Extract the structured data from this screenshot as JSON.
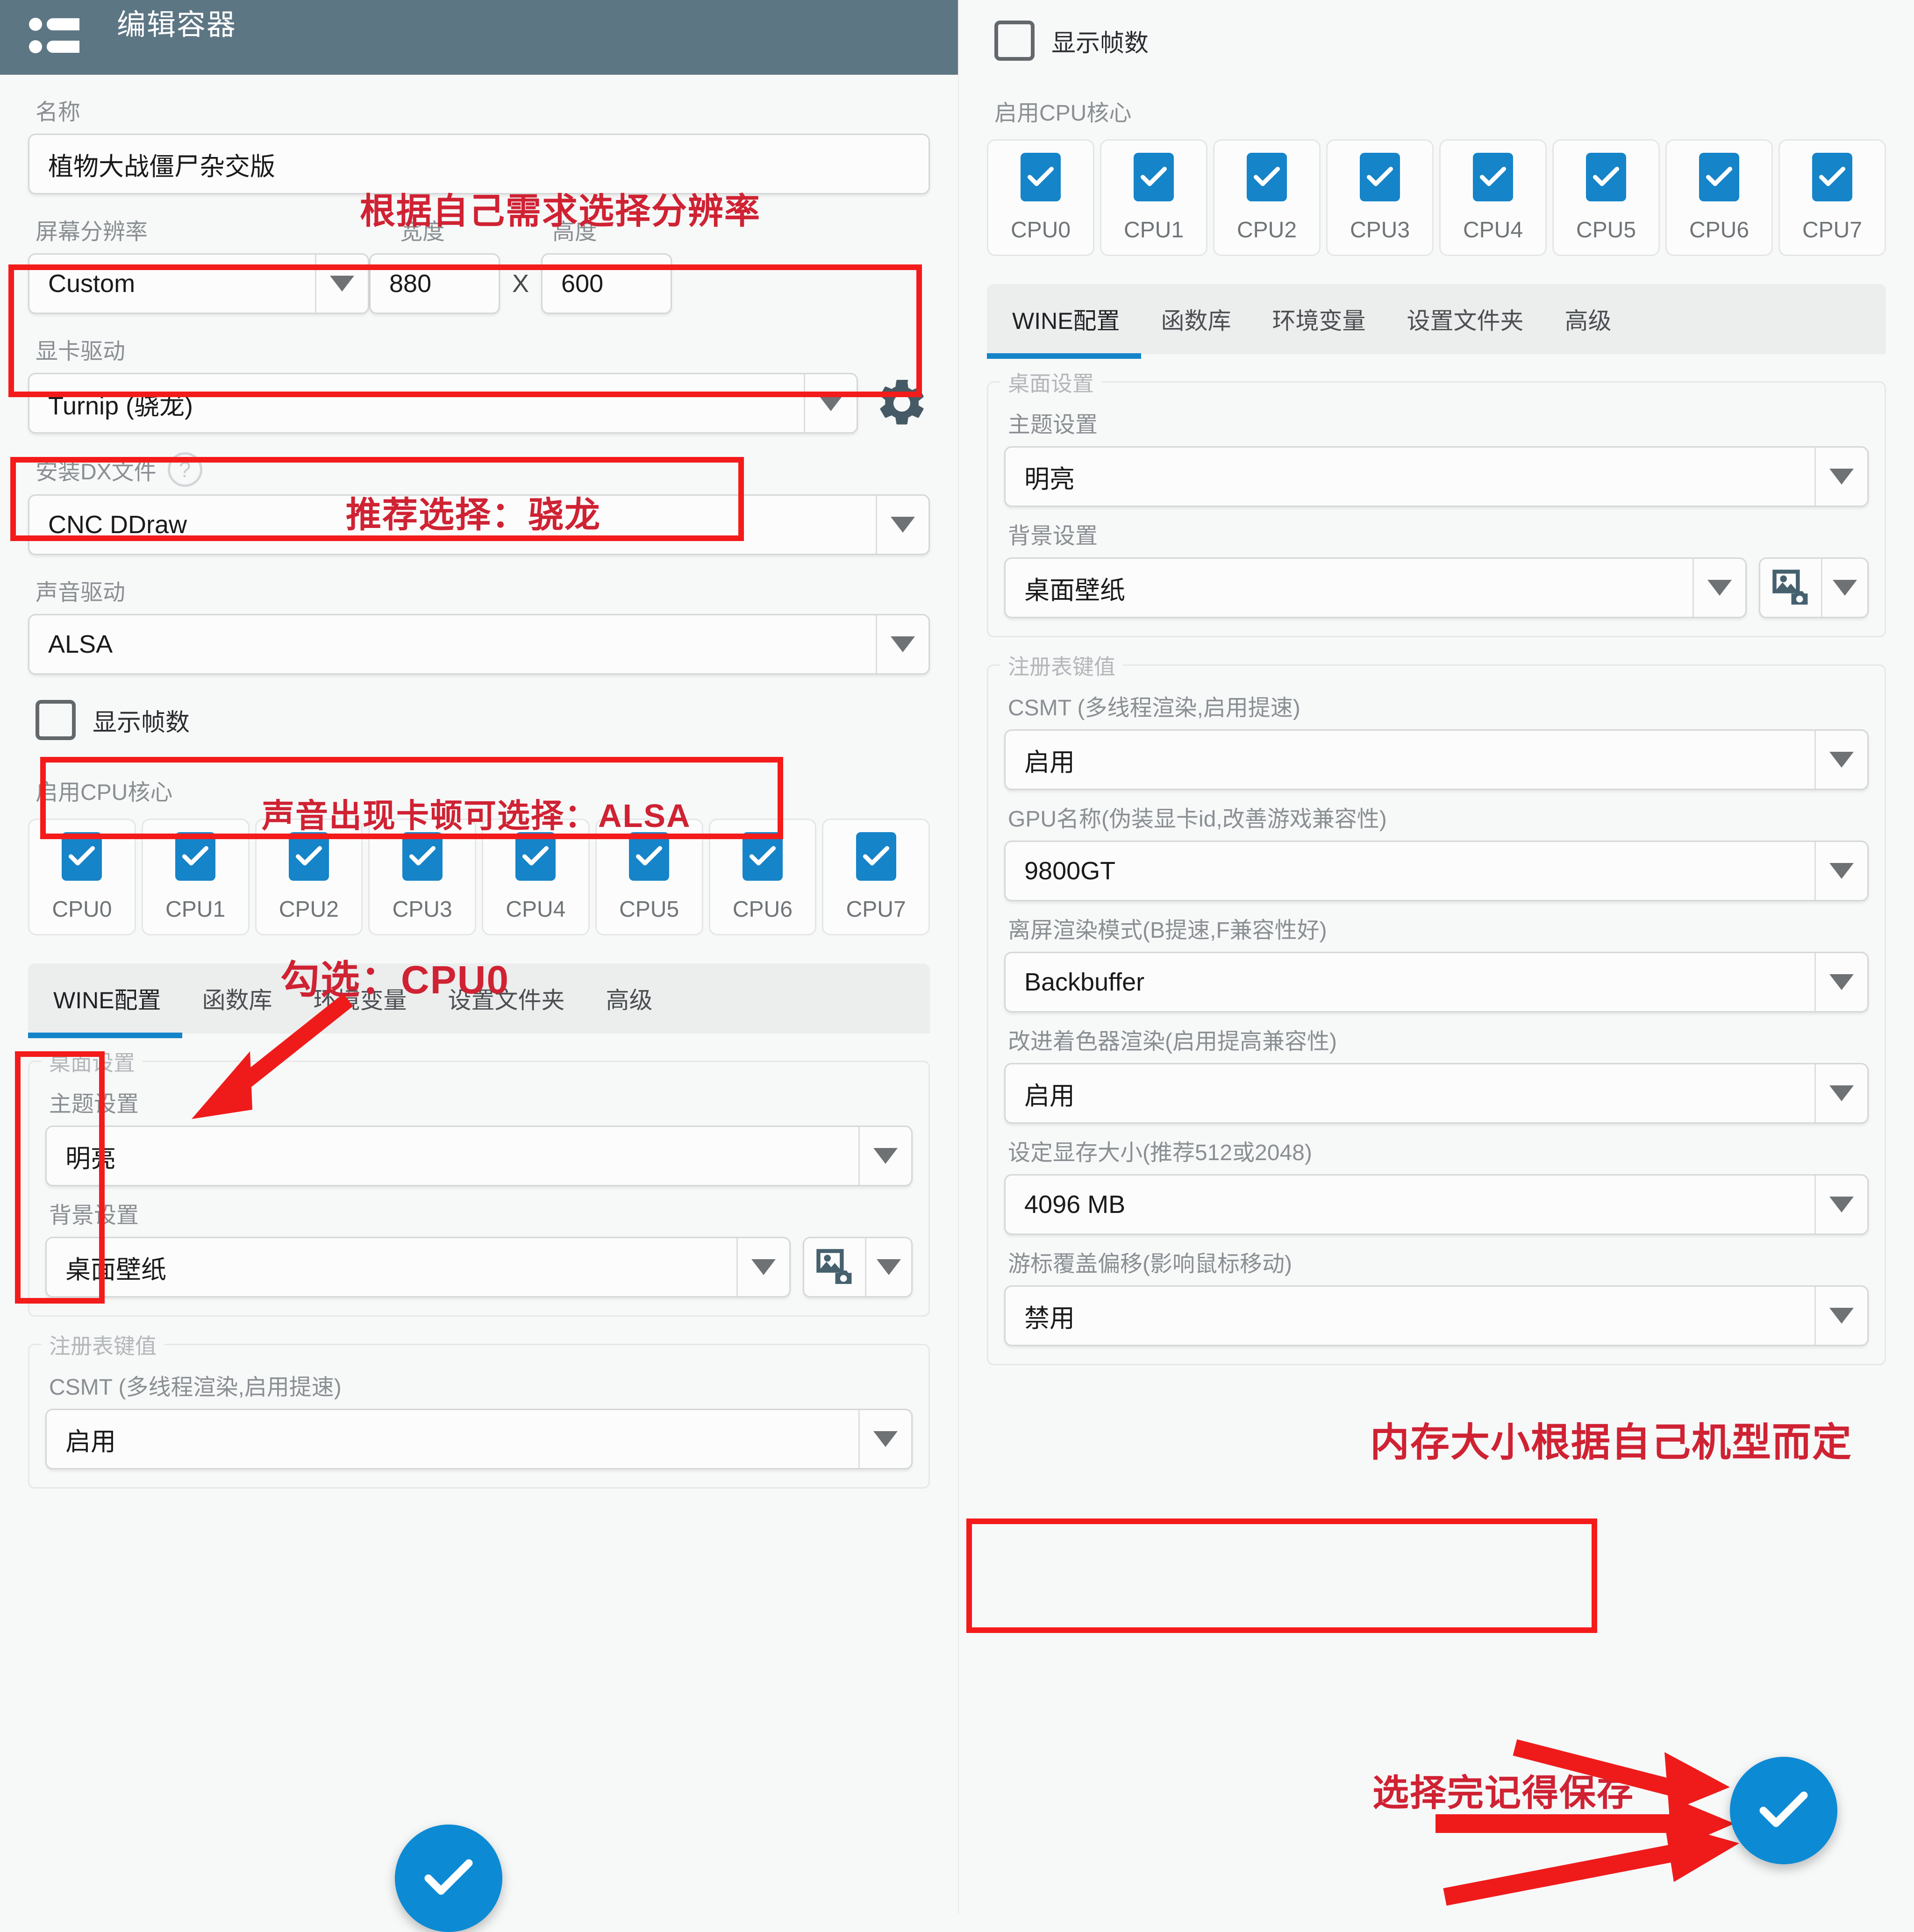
{
  "appbar": {
    "title": "编辑容器",
    "menu_icon": "list-icon"
  },
  "left_panel": {
    "name_label": "名称",
    "name_value": "植物大战僵尸杂交版",
    "resolution_label": "屏幕分辨率",
    "width_label": "宽度",
    "height_label": "高度",
    "resolution_value": "Custom",
    "width_value": "880",
    "height_value": "600",
    "x_separator": "X",
    "gfx_label": "显卡驱动",
    "gfx_value": "Turnip (骁龙)",
    "gear_icon": "gear-icon",
    "dx_label": "安装DX文件",
    "dx_help": "?",
    "dx_value": "CNC DDraw",
    "audio_label": "声音驱动",
    "audio_value": "ALSA",
    "fps_label": "显示帧数",
    "cpu_label": "启用CPU核心",
    "cpu_cores": [
      "CPU0",
      "CPU1",
      "CPU2",
      "CPU3",
      "CPU4",
      "CPU5",
      "CPU6",
      "CPU7"
    ],
    "tabs": [
      "WINE配置",
      "函数库",
      "环境变量",
      "设置文件夹",
      "高级"
    ],
    "active_tab": "WINE配置",
    "desktop_group": "桌面设置",
    "theme_label": "主题设置",
    "theme_value": "明亮",
    "background_label": "背景设置",
    "background_value": "桌面壁纸",
    "registry_group": "注册表键值",
    "csmt_label": "CSMT (多线程渲染,启用提速)",
    "csmt_value": "启用"
  },
  "right_panel": {
    "fps_label": "显示帧数",
    "cpu_label": "启用CPU核心",
    "cpu_cores": [
      "CPU0",
      "CPU1",
      "CPU2",
      "CPU3",
      "CPU4",
      "CPU5",
      "CPU6",
      "CPU7"
    ],
    "tabs": [
      "WINE配置",
      "函数库",
      "环境变量",
      "设置文件夹",
      "高级"
    ],
    "active_tab": "WINE配置",
    "desktop_group": "桌面设置",
    "theme_label": "主题设置",
    "theme_value": "明亮",
    "background_label": "背景设置",
    "background_value": "桌面壁纸",
    "registry_group": "注册表键值",
    "csmt_label": "CSMT (多线程渲染,启用提速)",
    "csmt_value": "启用",
    "gpu_label": "GPU名称(伪装显卡id,改善游戏兼容性)",
    "gpu_value": "9800GT",
    "offscreen_label": "离屏渲染模式(B提速,F兼容性好)",
    "offscreen_value": "Backbuffer",
    "shader_label": "改进着色器渲染(启用提高兼容性)",
    "shader_value": "启用",
    "vram_label": "设定显存大小(推荐512或2048)",
    "vram_value": "4096 MB",
    "cursor_label": "游标覆盖偏移(影响鼠标移动)",
    "cursor_value": "禁用"
  },
  "annotations": {
    "resolution_hint": "根据自己需求选择分辨率",
    "gfx_hint": "推荐选择：骁龙",
    "audio_hint": "声音出现卡顿可选择：ALSA",
    "cpu_hint": "勾选：CPU0",
    "memory_hint": "内存大小根据自己机型而定",
    "save_hint": "选择完记得保存"
  },
  "colors": {
    "appbar": "#5d7684",
    "accent": "#1484c9",
    "fab": "#0d8ad4",
    "annotation_red": "#cf2233",
    "box_red": "#f41b1b",
    "checkbox_blue": "#1684c8",
    "gear": "#455a64"
  }
}
